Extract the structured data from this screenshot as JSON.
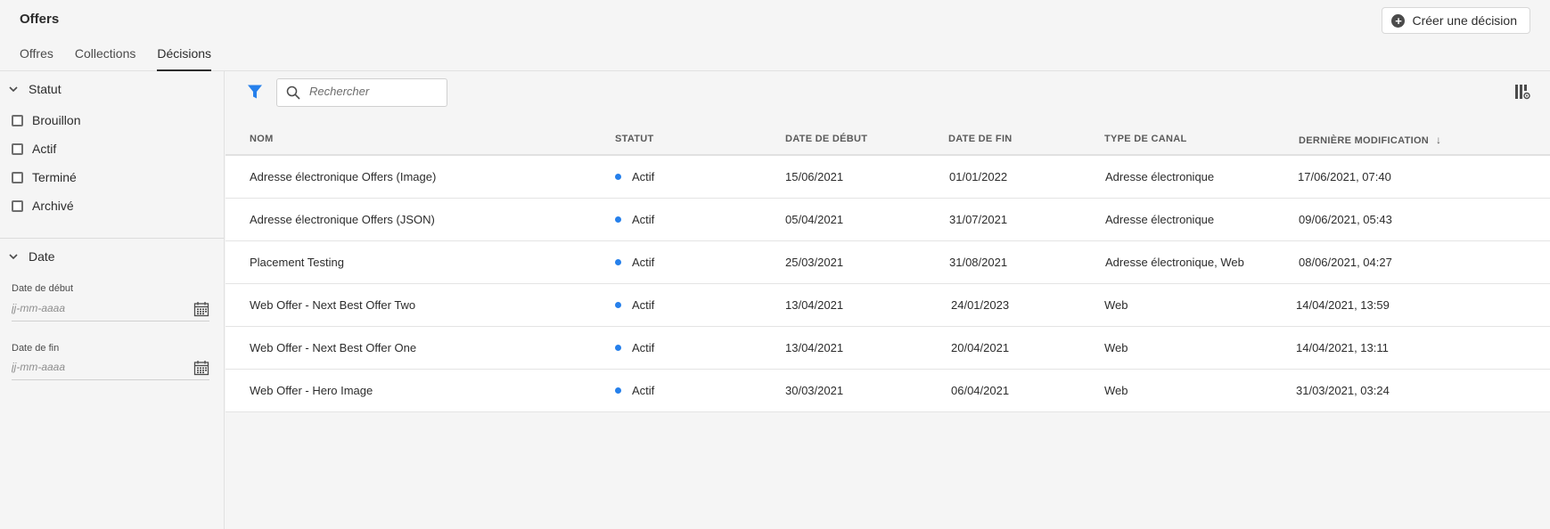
{
  "app": {
    "title": "Offers"
  },
  "tabs": [
    {
      "label": "Offres"
    },
    {
      "label": "Collections"
    },
    {
      "label": "Décisions",
      "active": true
    }
  ],
  "create_button": {
    "label": "Créer une décision",
    "icon": "plus-circle-icon"
  },
  "sidebar": {
    "status_section": {
      "title": "Statut",
      "options": [
        "Brouillon",
        "Actif",
        "Terminé",
        "Archivé"
      ]
    },
    "date_section": {
      "title": "Date",
      "start_label": "Date de début",
      "start_placeholder": "jj-mm-aaaa",
      "end_label": "Date de fin",
      "end_placeholder": "jj-mm-aaaa"
    }
  },
  "toolbar": {
    "search_placeholder": "Rechercher"
  },
  "table": {
    "columns": [
      "NOM",
      "STATUT",
      "DATE DE DÉBUT",
      "DATE DE FIN",
      "TYPE DE CANAL",
      "DERNIÈRE MODIFICATION"
    ],
    "sort_column": "DERNIÈRE MODIFICATION",
    "sort_direction": "descending",
    "rows": [
      {
        "name": "Adresse électronique Offers (Image)",
        "status": "Actif",
        "start": "15/06/2021",
        "end": "01/01/2022",
        "channel": "Adresse électronique",
        "modified": "17/06/2021, 07:40"
      },
      {
        "name": "Adresse électronique Offers (JSON)",
        "status": "Actif",
        "start": "05/04/2021",
        "end": "31/07/2021",
        "channel": "Adresse électronique",
        "modified": "09/06/2021, 05:43"
      },
      {
        "name": "Placement Testing",
        "status": "Actif",
        "start": "25/03/2021",
        "end": "31/08/2021",
        "channel": "Adresse électronique, Web",
        "modified": "08/06/2021, 04:27"
      },
      {
        "name": "Web Offer - Next Best Offer Two",
        "status": "Actif",
        "start": "13/04/2021",
        "end": "24/01/2023",
        "channel": "Web",
        "modified": "14/04/2021, 13:59"
      },
      {
        "name": "Web Offer - Next Best Offer One",
        "status": "Actif",
        "start": "13/04/2021",
        "end": "20/04/2021",
        "channel": "Web",
        "modified": "14/04/2021, 13:11"
      },
      {
        "name": "Web Offer - Hero Image",
        "status": "Actif",
        "start": "30/03/2021",
        "end": "06/04/2021",
        "channel": "Web",
        "modified": "31/03/2021, 03:24"
      }
    ]
  },
  "colors": {
    "accent": "#2680eb",
    "status_active": "#2680eb",
    "background": "#f5f5f5"
  }
}
